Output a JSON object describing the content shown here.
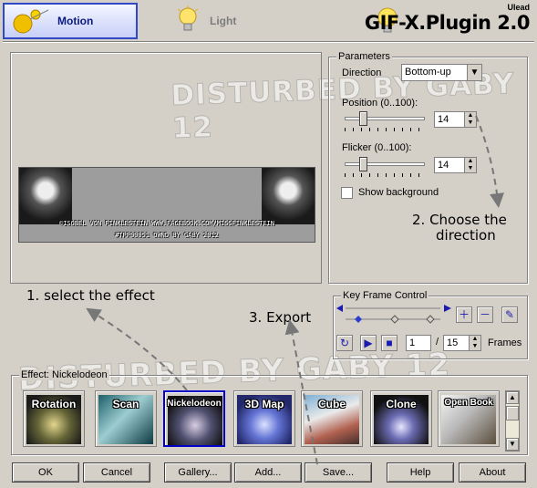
{
  "header": {
    "tabs": [
      {
        "label": "Motion",
        "icon": "motion-icon"
      },
      {
        "label": "Light",
        "icon": "lightbulb-icon"
      }
    ],
    "logo_small": "Ulead",
    "logo_title": "GIF-X.Plugin 2.0"
  },
  "watermark": "DISTURBED BY GABY 12",
  "preview": {
    "caption_line1": "©ISOBEL VON FINKLESTEIN WWW.FACEBOOK.COM/MISSFINKLESTEIN",
    "caption_line2": "#TPP00051 OWND BY GABY 2012"
  },
  "parameters": {
    "title": "Parameters",
    "direction_label": "Direction",
    "direction_value": "Bottom-up",
    "position_label": "Position (0..100):",
    "position_value": "14",
    "flicker_label": "Flicker (0..100):",
    "flicker_value": "14",
    "show_background_label": "Show background"
  },
  "keyframe": {
    "title": "Key Frame Control",
    "current_frame": "1",
    "separator": "/",
    "total_frames": "15",
    "frames_label": "Frames"
  },
  "instructions": {
    "step1": "1. select the effect",
    "step2_line1": "2. Choose the",
    "step2_line2": "direction",
    "step3": "3. Export"
  },
  "effects": {
    "title": "Effect: Nickelodeon",
    "items": [
      "Rotation",
      "Scan",
      "Nickelodeon",
      "3D Map",
      "Cube",
      "Clone",
      "Open Book"
    ],
    "selected": "Nickelodeon"
  },
  "buttons": {
    "ok": "OK",
    "cancel": "Cancel",
    "gallery": "Gallery...",
    "add": "Add...",
    "save": "Save...",
    "help": "Help",
    "about": "About"
  },
  "colors": {
    "window_bg": "#d4d0c8",
    "tab_accent": "#2f49c8",
    "selected_effect_border": "#0000c8"
  }
}
